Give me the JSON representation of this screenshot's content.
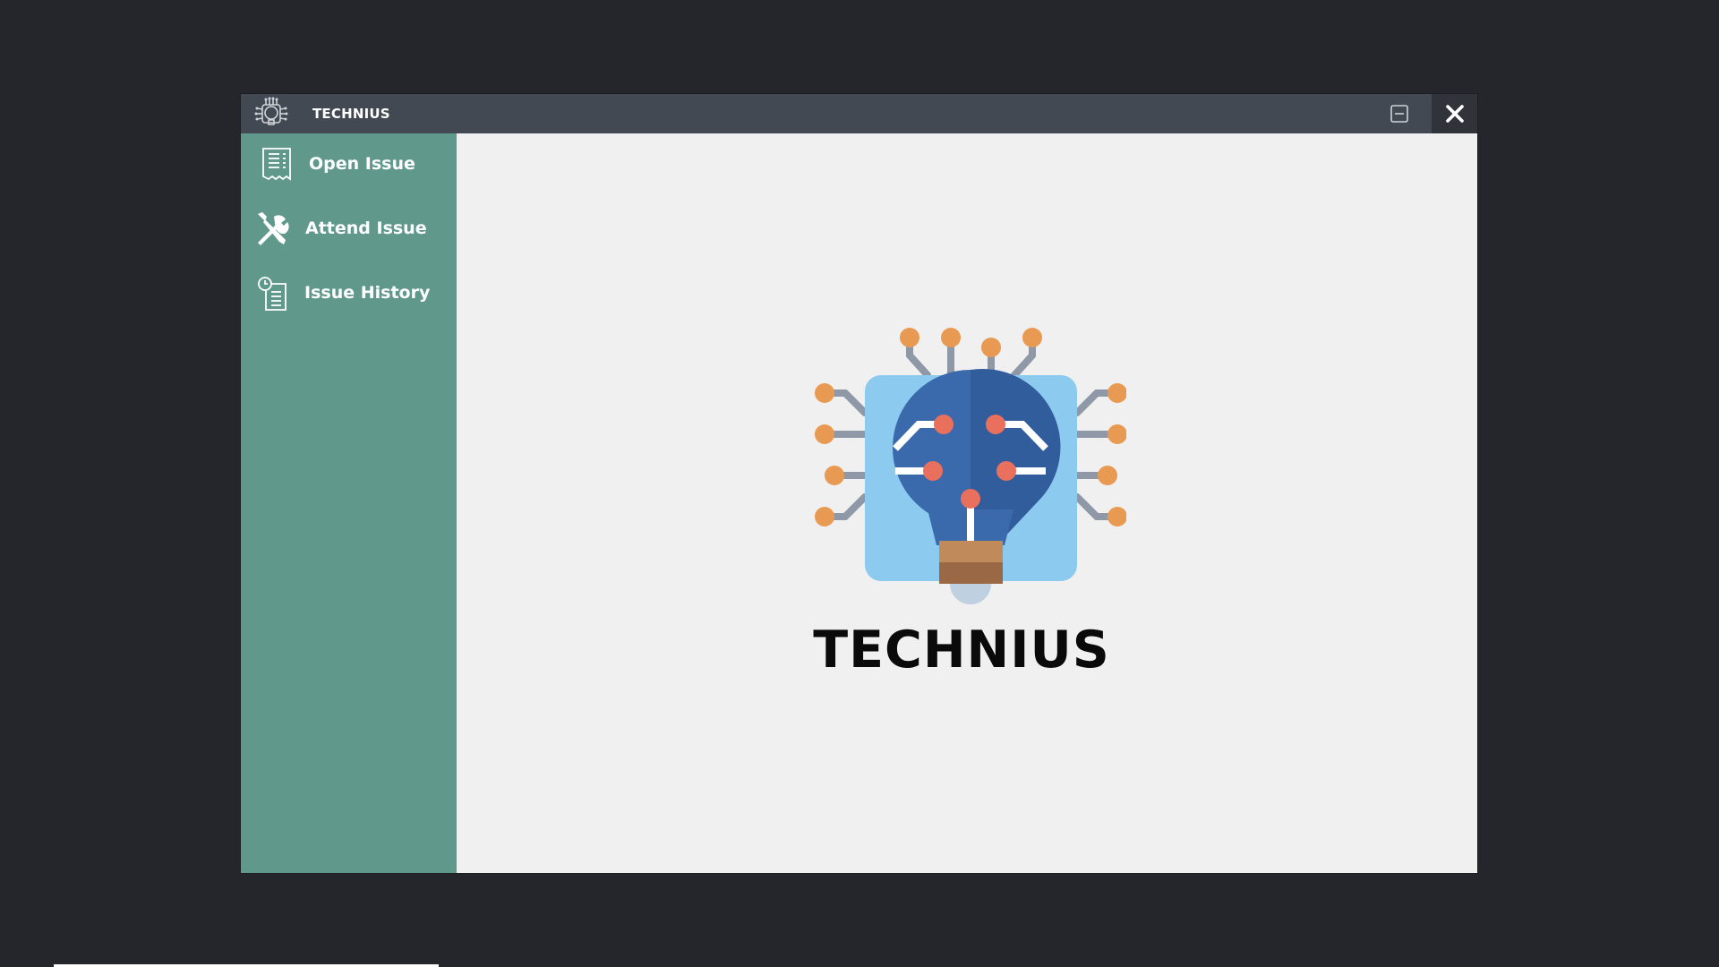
{
  "window": {
    "title": "TECHNIUS"
  },
  "sidebar": {
    "items": [
      {
        "label": "Open Issue",
        "icon": "receipt-icon"
      },
      {
        "label": "Attend Issue",
        "icon": "tools-icon"
      },
      {
        "label": "Issue History",
        "icon": "history-document-icon"
      }
    ]
  },
  "main": {
    "app_name": "TECHNIUS",
    "logo_icon": "circuit-lightbulb-icon"
  },
  "colors": {
    "titlebar": "#434953",
    "sidebar": "#60998c",
    "content_bg": "#f0f0f0",
    "desktop_bg": "#24262b"
  }
}
